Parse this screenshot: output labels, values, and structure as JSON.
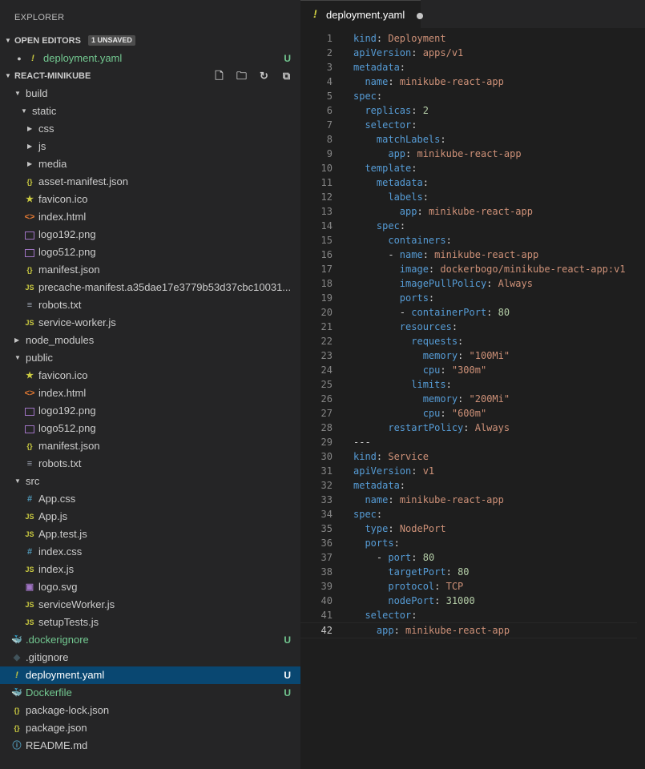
{
  "sidebar": {
    "title": "EXPLORER",
    "open_editors": {
      "label": "OPEN EDITORS",
      "badge": "1 UNSAVED",
      "file": "deployment.yaml",
      "status": "U"
    },
    "project": {
      "label": "REACT-MINIKUBE"
    },
    "tree": [
      {
        "name": "build",
        "kind": "folder",
        "expanded": true,
        "depth": 1
      },
      {
        "name": "static",
        "kind": "folder",
        "expanded": true,
        "depth": 2
      },
      {
        "name": "css",
        "kind": "folder",
        "expanded": false,
        "depth": 3
      },
      {
        "name": "js",
        "kind": "folder",
        "expanded": false,
        "depth": 3
      },
      {
        "name": "media",
        "kind": "folder",
        "expanded": false,
        "depth": 3
      },
      {
        "name": "asset-manifest.json",
        "kind": "json",
        "depth": 2
      },
      {
        "name": "favicon.ico",
        "kind": "star",
        "depth": 2
      },
      {
        "name": "index.html",
        "kind": "html",
        "depth": 2
      },
      {
        "name": "logo192.png",
        "kind": "image",
        "depth": 2
      },
      {
        "name": "logo512.png",
        "kind": "image",
        "depth": 2
      },
      {
        "name": "manifest.json",
        "kind": "json",
        "depth": 2
      },
      {
        "name": "precache-manifest.a35dae17e3779b53d37cbc10031...",
        "kind": "js",
        "depth": 2
      },
      {
        "name": "robots.txt",
        "kind": "text",
        "depth": 2
      },
      {
        "name": "service-worker.js",
        "kind": "js",
        "depth": 2
      },
      {
        "name": "node_modules",
        "kind": "folder",
        "expanded": false,
        "depth": 1
      },
      {
        "name": "public",
        "kind": "folder",
        "expanded": true,
        "depth": 1
      },
      {
        "name": "favicon.ico",
        "kind": "star",
        "depth": 2
      },
      {
        "name": "index.html",
        "kind": "html",
        "depth": 2
      },
      {
        "name": "logo192.png",
        "kind": "image",
        "depth": 2
      },
      {
        "name": "logo512.png",
        "kind": "image",
        "depth": 2
      },
      {
        "name": "manifest.json",
        "kind": "json",
        "depth": 2
      },
      {
        "name": "robots.txt",
        "kind": "text",
        "depth": 2
      },
      {
        "name": "src",
        "kind": "folder",
        "expanded": true,
        "depth": 1
      },
      {
        "name": "App.css",
        "kind": "css",
        "depth": 2
      },
      {
        "name": "App.js",
        "kind": "js",
        "depth": 2
      },
      {
        "name": "App.test.js",
        "kind": "js",
        "depth": 2
      },
      {
        "name": "index.css",
        "kind": "css",
        "depth": 2
      },
      {
        "name": "index.js",
        "kind": "js",
        "depth": 2
      },
      {
        "name": "logo.svg",
        "kind": "svg",
        "depth": 2
      },
      {
        "name": "serviceWorker.js",
        "kind": "js",
        "depth": 2
      },
      {
        "name": "setupTests.js",
        "kind": "js",
        "depth": 2
      },
      {
        "name": ".dockerignore",
        "kind": "docker",
        "depth": 1,
        "status": "U",
        "color": "#73c991"
      },
      {
        "name": ".gitignore",
        "kind": "git",
        "depth": 1
      },
      {
        "name": "deployment.yaml",
        "kind": "yaml",
        "depth": 1,
        "status": "U",
        "selected": true
      },
      {
        "name": "Dockerfile",
        "kind": "docker",
        "depth": 1,
        "status": "U",
        "color": "#73c991"
      },
      {
        "name": "package-lock.json",
        "kind": "json",
        "depth": 1
      },
      {
        "name": "package.json",
        "kind": "json",
        "depth": 1
      },
      {
        "name": "README.md",
        "kind": "info",
        "depth": 1
      }
    ]
  },
  "editor": {
    "tab": {
      "name": "deployment.yaml"
    },
    "lines": [
      [
        [
          "k",
          "kind"
        ],
        [
          "p",
          ": "
        ],
        [
          "s",
          "Deployment"
        ]
      ],
      [
        [
          "k",
          "apiVersion"
        ],
        [
          "p",
          ": "
        ],
        [
          "s",
          "apps/v1"
        ]
      ],
      [
        [
          "k",
          "metadata"
        ],
        [
          "p",
          ":"
        ]
      ],
      [
        [
          "p",
          "  "
        ],
        [
          "k",
          "name"
        ],
        [
          "p",
          ": "
        ],
        [
          "s",
          "minikube-react-app"
        ]
      ],
      [
        [
          "k",
          "spec"
        ],
        [
          "p",
          ":"
        ]
      ],
      [
        [
          "p",
          "  "
        ],
        [
          "k",
          "replicas"
        ],
        [
          "p",
          ": "
        ],
        [
          "n",
          "2"
        ]
      ],
      [
        [
          "p",
          "  "
        ],
        [
          "k",
          "selector"
        ],
        [
          "p",
          ":"
        ]
      ],
      [
        [
          "p",
          "    "
        ],
        [
          "k",
          "matchLabels"
        ],
        [
          "p",
          ":"
        ]
      ],
      [
        [
          "p",
          "      "
        ],
        [
          "k",
          "app"
        ],
        [
          "p",
          ": "
        ],
        [
          "s",
          "minikube-react-app"
        ]
      ],
      [
        [
          "p",
          "  "
        ],
        [
          "k",
          "template"
        ],
        [
          "p",
          ":"
        ]
      ],
      [
        [
          "p",
          "    "
        ],
        [
          "k",
          "metadata"
        ],
        [
          "p",
          ":"
        ]
      ],
      [
        [
          "p",
          "      "
        ],
        [
          "k",
          "labels"
        ],
        [
          "p",
          ":"
        ]
      ],
      [
        [
          "p",
          "        "
        ],
        [
          "k",
          "app"
        ],
        [
          "p",
          ": "
        ],
        [
          "s",
          "minikube-react-app"
        ]
      ],
      [
        [
          "p",
          "    "
        ],
        [
          "k",
          "spec"
        ],
        [
          "p",
          ":"
        ]
      ],
      [
        [
          "p",
          "      "
        ],
        [
          "k",
          "containers"
        ],
        [
          "p",
          ":"
        ]
      ],
      [
        [
          "p",
          "      - "
        ],
        [
          "k",
          "name"
        ],
        [
          "p",
          ": "
        ],
        [
          "s",
          "minikube-react-app"
        ]
      ],
      [
        [
          "p",
          "        "
        ],
        [
          "k",
          "image"
        ],
        [
          "p",
          ": "
        ],
        [
          "s",
          "dockerbogo/minikube-react-app:v1"
        ]
      ],
      [
        [
          "p",
          "        "
        ],
        [
          "k",
          "imagePullPolicy"
        ],
        [
          "p",
          ": "
        ],
        [
          "s",
          "Always"
        ]
      ],
      [
        [
          "p",
          "        "
        ],
        [
          "k",
          "ports"
        ],
        [
          "p",
          ":"
        ]
      ],
      [
        [
          "p",
          "        - "
        ],
        [
          "k",
          "containerPort"
        ],
        [
          "p",
          ": "
        ],
        [
          "n",
          "80"
        ]
      ],
      [
        [
          "p",
          "        "
        ],
        [
          "k",
          "resources"
        ],
        [
          "p",
          ":"
        ]
      ],
      [
        [
          "p",
          "          "
        ],
        [
          "k",
          "requests"
        ],
        [
          "p",
          ":"
        ]
      ],
      [
        [
          "p",
          "            "
        ],
        [
          "k",
          "memory"
        ],
        [
          "p",
          ": "
        ],
        [
          "s",
          "\"100Mi\""
        ]
      ],
      [
        [
          "p",
          "            "
        ],
        [
          "k",
          "cpu"
        ],
        [
          "p",
          ": "
        ],
        [
          "s",
          "\"300m\""
        ]
      ],
      [
        [
          "p",
          "          "
        ],
        [
          "k",
          "limits"
        ],
        [
          "p",
          ":"
        ]
      ],
      [
        [
          "p",
          "            "
        ],
        [
          "k",
          "memory"
        ],
        [
          "p",
          ": "
        ],
        [
          "s",
          "\"200Mi\""
        ]
      ],
      [
        [
          "p",
          "            "
        ],
        [
          "k",
          "cpu"
        ],
        [
          "p",
          ": "
        ],
        [
          "s",
          "\"600m\""
        ]
      ],
      [
        [
          "p",
          "      "
        ],
        [
          "k",
          "restartPolicy"
        ],
        [
          "p",
          ": "
        ],
        [
          "s",
          "Always"
        ]
      ],
      [
        [
          "p",
          "---"
        ]
      ],
      [
        [
          "k",
          "kind"
        ],
        [
          "p",
          ": "
        ],
        [
          "s",
          "Service"
        ]
      ],
      [
        [
          "k",
          "apiVersion"
        ],
        [
          "p",
          ": "
        ],
        [
          "s",
          "v1"
        ]
      ],
      [
        [
          "k",
          "metadata"
        ],
        [
          "p",
          ":"
        ]
      ],
      [
        [
          "p",
          "  "
        ],
        [
          "k",
          "name"
        ],
        [
          "p",
          ": "
        ],
        [
          "s",
          "minikube-react-app"
        ]
      ],
      [
        [
          "k",
          "spec"
        ],
        [
          "p",
          ":"
        ]
      ],
      [
        [
          "p",
          "  "
        ],
        [
          "k",
          "type"
        ],
        [
          "p",
          ": "
        ],
        [
          "s",
          "NodePort"
        ]
      ],
      [
        [
          "p",
          "  "
        ],
        [
          "k",
          "ports"
        ],
        [
          "p",
          ":"
        ]
      ],
      [
        [
          "p",
          "    - "
        ],
        [
          "k",
          "port"
        ],
        [
          "p",
          ": "
        ],
        [
          "n",
          "80"
        ]
      ],
      [
        [
          "p",
          "      "
        ],
        [
          "k",
          "targetPort"
        ],
        [
          "p",
          ": "
        ],
        [
          "n",
          "80"
        ]
      ],
      [
        [
          "p",
          "      "
        ],
        [
          "k",
          "protocol"
        ],
        [
          "p",
          ": "
        ],
        [
          "s",
          "TCP"
        ]
      ],
      [
        [
          "p",
          "      "
        ],
        [
          "k",
          "nodePort"
        ],
        [
          "p",
          ": "
        ],
        [
          "n",
          "31000"
        ]
      ],
      [
        [
          "p",
          "  "
        ],
        [
          "k",
          "selector"
        ],
        [
          "p",
          ":"
        ]
      ],
      [
        [
          "p",
          "    "
        ],
        [
          "k",
          "app"
        ],
        [
          "p",
          ": "
        ],
        [
          "s",
          "minikube-react-app"
        ]
      ]
    ]
  }
}
